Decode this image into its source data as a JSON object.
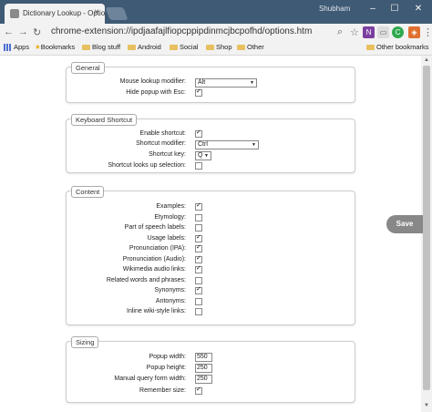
{
  "browser": {
    "tab_title": "Dictionary Lookup - Optio",
    "user_name": "Shubham",
    "url": "chrome-extension://ipdjaafajlfiopcppipdinmcjbcpofhd/options.htm",
    "extensions": [
      "zoom-icon",
      "star-icon",
      "onenote-icon",
      "app-icon",
      "green-icon",
      "menu-icon"
    ]
  },
  "bookmarks": {
    "items": [
      "Apps",
      "Bookmarks",
      "Blog stuff",
      "Android",
      "Social",
      "Shop",
      "Other"
    ],
    "other": "Other bookmarks"
  },
  "general": {
    "legend": "General",
    "mouse_label": "Mouse lookup modifier:",
    "mouse_value": "Alt",
    "hide_label": "Hide popup with Esc:",
    "hide_checked": true
  },
  "shortcut": {
    "legend": "Keyboard Shortcut",
    "enable_label": "Enable shortcut:",
    "enable_checked": true,
    "modifier_label": "Shortcut modifier:",
    "modifier_value": "Ctrl",
    "key_label": "Shortcut key:",
    "key_value": "Q",
    "selection_label": "Shortcut looks up selection:",
    "selection_checked": false
  },
  "content": {
    "legend": "Content",
    "options": [
      {
        "label": "Examples:",
        "checked": true
      },
      {
        "label": "Etymology:",
        "checked": false
      },
      {
        "label": "Part of speech labels:",
        "checked": false
      },
      {
        "label": "Usage labels:",
        "checked": true
      },
      {
        "label": "Pronunciation (IPA):",
        "checked": true
      },
      {
        "label": "Pronunciation (Audio):",
        "checked": true
      },
      {
        "label": "Wikimedia audio links:",
        "checked": true
      },
      {
        "label": "Related words and phrases:",
        "checked": false
      },
      {
        "label": "Synonyms:",
        "checked": true
      },
      {
        "label": "Antonyms:",
        "checked": false
      },
      {
        "label": "Inline wiki-style links:",
        "checked": false
      }
    ]
  },
  "sizing": {
    "legend": "Sizing",
    "width_label": "Popup width:",
    "width_value": "550",
    "height_label": "Popup height:",
    "height_value": "250",
    "query_label": "Manual query form width:",
    "query_value": "250",
    "remember_label": "Remember size:",
    "remember_checked": true
  },
  "save_label": "Save"
}
